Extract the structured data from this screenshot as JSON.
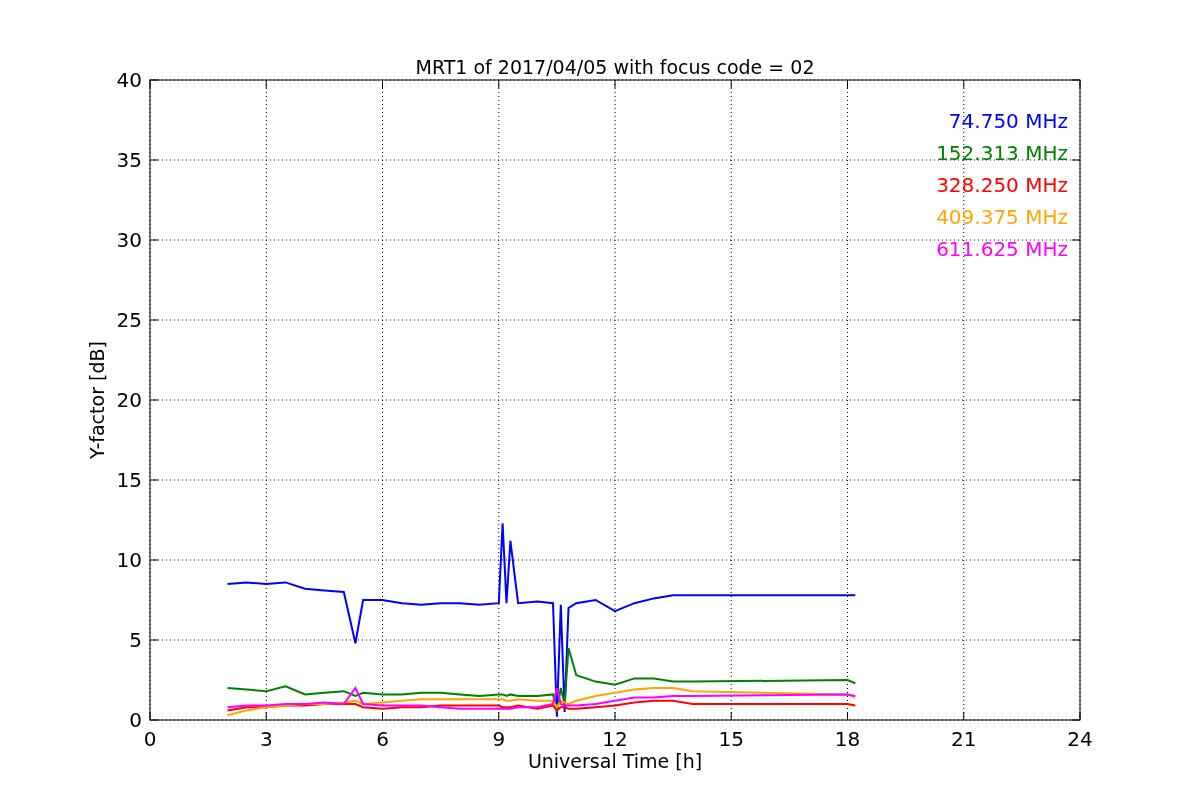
{
  "figure": {
    "chart_data": {
      "type": "line",
      "title": "MRT1 of 2017/04/05 with focus code = 02",
      "xlabel": "Universal Time [h]",
      "ylabel": "Y-factor [dB]",
      "x": [
        2,
        2.5,
        3,
        3.5,
        4,
        4.5,
        5,
        5.3,
        5.5,
        6,
        6.5,
        7,
        7.5,
        8,
        8.5,
        9,
        9.1,
        9.2,
        9.3,
        9.5,
        10,
        10.4,
        10.5,
        10.6,
        10.7,
        10.8,
        11,
        11.5,
        12,
        12.5,
        13,
        13.5,
        14,
        18,
        18.2
      ],
      "series": [
        {
          "name": "74.750 MHz",
          "color": "#0000ff",
          "values": [
            8.5,
            8.6,
            8.5,
            8.6,
            8.2,
            8.1,
            8.0,
            4.8,
            7.5,
            7.5,
            7.3,
            7.2,
            7.3,
            7.3,
            7.2,
            7.3,
            12.3,
            7.3,
            11.2,
            7.3,
            7.4,
            7.3,
            0.2,
            7.2,
            0.5,
            7.0,
            7.3,
            7.5,
            6.8,
            7.3,
            7.6,
            7.8,
            7.8,
            7.8,
            7.8
          ]
        },
        {
          "name": "152.313 MHz",
          "color": "#008000",
          "values": [
            2.0,
            1.9,
            1.8,
            2.1,
            1.6,
            1.7,
            1.8,
            1.5,
            1.7,
            1.6,
            1.6,
            1.7,
            1.7,
            1.6,
            1.5,
            1.6,
            1.6,
            1.5,
            1.6,
            1.5,
            1.5,
            1.6,
            0.5,
            2.0,
            1.0,
            4.5,
            2.8,
            2.4,
            2.2,
            2.6,
            2.6,
            2.4,
            2.4,
            2.5,
            2.3
          ]
        },
        {
          "name": "328.250 MHz",
          "color": "#ff0000",
          "values": [
            0.6,
            0.8,
            0.8,
            0.9,
            0.9,
            1.0,
            1.0,
            1.0,
            0.8,
            0.7,
            0.8,
            0.8,
            0.9,
            0.9,
            0.9,
            0.9,
            0.8,
            0.8,
            0.8,
            0.9,
            0.7,
            0.9,
            0.6,
            0.8,
            0.8,
            0.7,
            0.7,
            0.8,
            0.9,
            1.1,
            1.2,
            1.2,
            1.0,
            1.0,
            0.9
          ]
        },
        {
          "name": "409.375 MHz",
          "color": "#ffa500",
          "values": [
            0.3,
            0.6,
            0.8,
            0.9,
            1.0,
            1.0,
            1.1,
            1.2,
            1.0,
            1.1,
            1.2,
            1.3,
            1.3,
            1.3,
            1.3,
            1.3,
            1.3,
            1.2,
            1.2,
            1.3,
            1.2,
            1.2,
            0.8,
            1.2,
            1.1,
            1.0,
            1.2,
            1.5,
            1.7,
            1.9,
            2.0,
            2.0,
            1.8,
            1.6,
            1.4
          ]
        },
        {
          "name": "611.625 MHz",
          "color": "#ff00ff",
          "values": [
            0.8,
            0.9,
            0.9,
            1.0,
            1.0,
            1.1,
            1.0,
            2.0,
            1.0,
            0.9,
            0.9,
            0.9,
            0.8,
            0.7,
            0.7,
            0.7,
            0.7,
            0.7,
            0.7,
            0.8,
            0.8,
            1.0,
            2.0,
            1.0,
            0.9,
            0.9,
            0.9,
            1.0,
            1.2,
            1.4,
            1.4,
            1.5,
            1.5,
            1.6,
            1.5
          ]
        }
      ],
      "xlim": [
        0,
        24
      ],
      "ylim": [
        0,
        40
      ],
      "xticks": [
        0,
        3,
        6,
        9,
        12,
        15,
        18,
        21,
        24
      ],
      "yticks": [
        0,
        5,
        10,
        15,
        20,
        25,
        30,
        35,
        40
      ],
      "grid": true
    }
  }
}
